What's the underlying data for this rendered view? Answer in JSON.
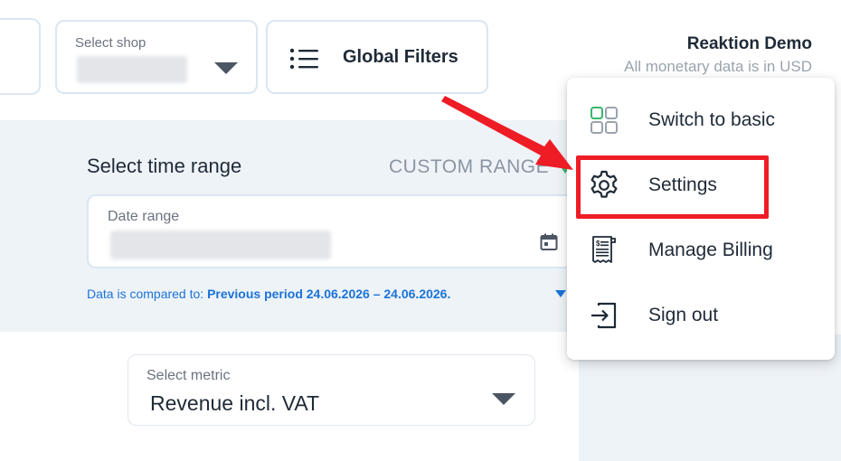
{
  "header": {
    "shop_select": {
      "label": "Select shop",
      "icon": "chevron-down-icon"
    },
    "global_filters": {
      "label": "Global Filters",
      "icon": "filter-list-icon"
    },
    "account": {
      "name": "Reaktion Demo",
      "currency_note": "All monetary data is in USD"
    }
  },
  "time_range": {
    "title": "Select time range",
    "mode": "CUSTOM RANGE",
    "date_range_label": "Date range",
    "compare_prefix": "Data is compared to:",
    "compare_value": "Previous period 24.06.2026 – 24.06.2026."
  },
  "metric": {
    "label": "Select metric",
    "value": "Revenue incl. VAT"
  },
  "menu": {
    "items": [
      {
        "label": "Switch to basic",
        "icon": "grid-icon"
      },
      {
        "label": "Settings",
        "icon": "gear-icon"
      },
      {
        "label": "Manage Billing",
        "icon": "receipt-icon"
      },
      {
        "label": "Sign out",
        "icon": "sign-out-icon"
      }
    ]
  },
  "colors": {
    "accent_green": "#35b76a",
    "link_blue": "#1a73d9",
    "highlight_red": "#ee1c25",
    "panel_bg": "#eef3f8",
    "border": "#dbe6f2"
  }
}
